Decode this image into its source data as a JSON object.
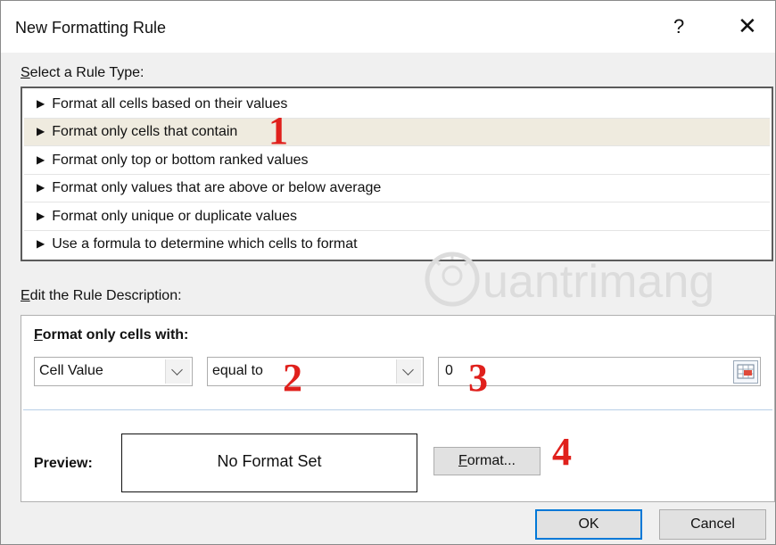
{
  "dialog": {
    "title": "New Formatting Rule",
    "help_label": "?",
    "close_label": "✕"
  },
  "rule_type": {
    "label_prefix": "S",
    "label_rest": "elect a Rule Type:",
    "items": [
      {
        "label": "Format all cells based on their values"
      },
      {
        "label": "Format only cells that contain"
      },
      {
        "label": "Format only top or bottom ranked values"
      },
      {
        "label": "Format only values that are above or below average"
      },
      {
        "label": "Format only unique or duplicate values"
      },
      {
        "label": "Use a formula to determine which cells to format"
      }
    ],
    "selected_index": 1
  },
  "description": {
    "label_prefix": "E",
    "label_rest": "dit the Rule Description:",
    "heading_prefix": "F",
    "heading_rest": "ormat only cells with:",
    "field1_value": "Cell Value",
    "field2_value": "equal to",
    "field3_value": "0",
    "preview_label": "Preview:",
    "preview_text": "No Format Set",
    "format_button_prefix": "F",
    "format_button_rest": "ormat..."
  },
  "footer": {
    "ok_label": "OK",
    "cancel_label": "Cancel"
  },
  "annotations": {
    "a1": "1",
    "a2": "2",
    "a3": "3",
    "a4": "4"
  },
  "watermark": {
    "text": "uantrimang"
  },
  "colors": {
    "selected_row": "#efebdf",
    "accent": "#0078d7",
    "annotation": "#e0201c"
  }
}
